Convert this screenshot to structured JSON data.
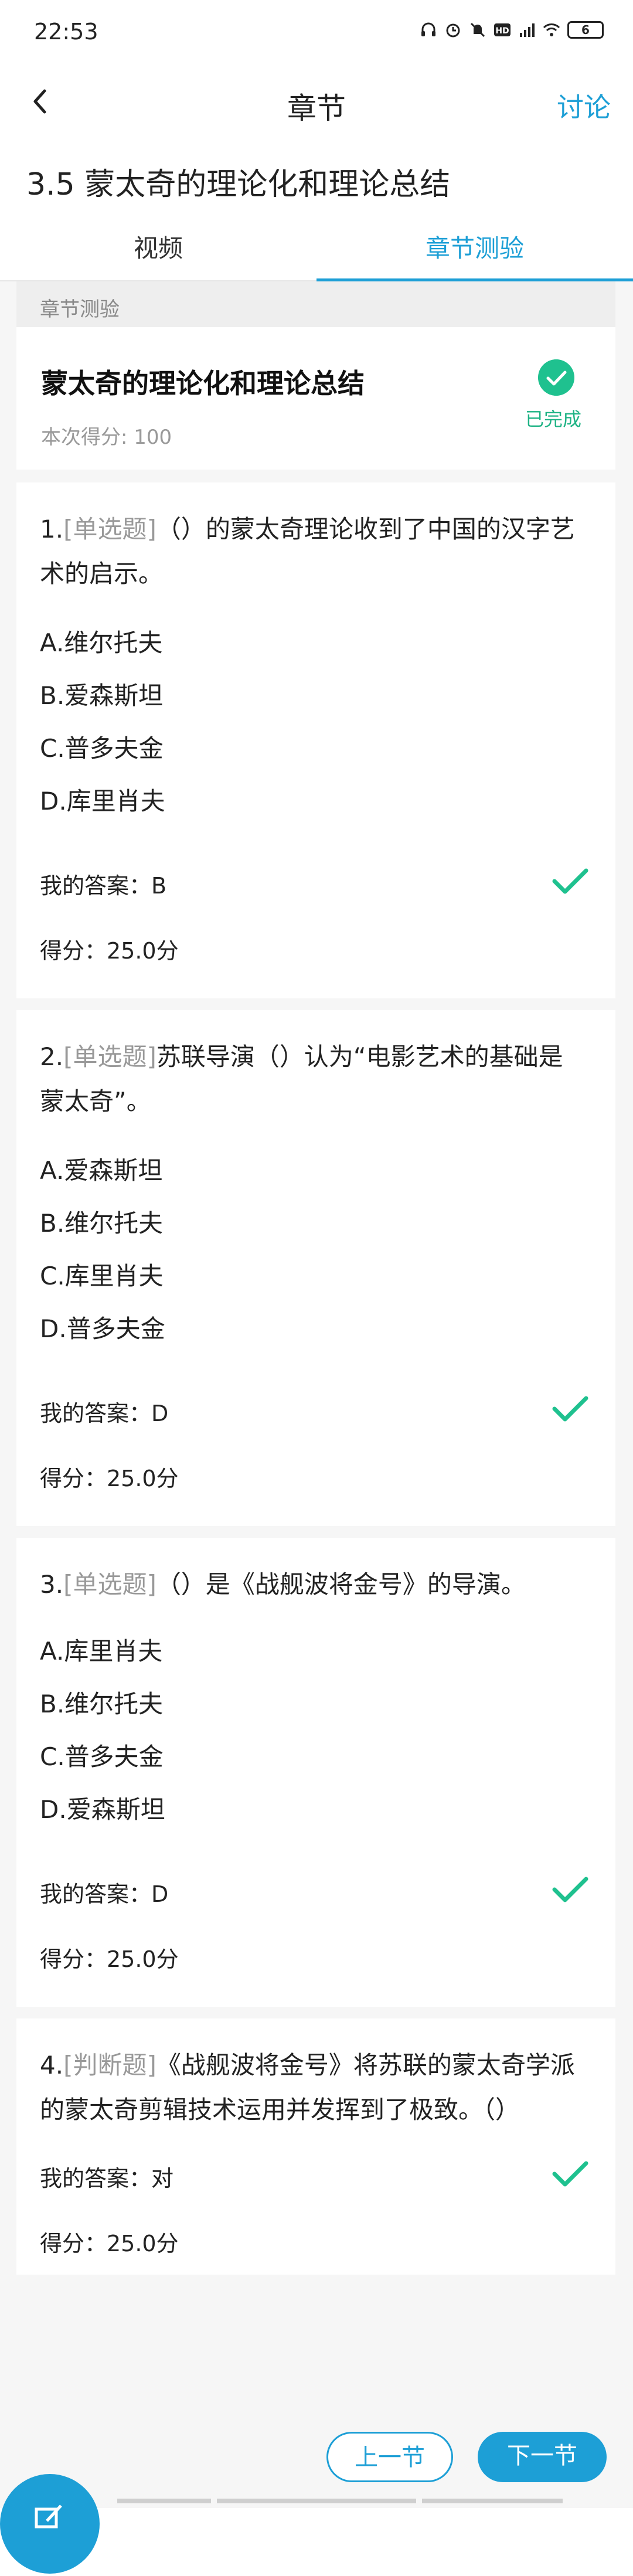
{
  "status_bar": {
    "time": "22:53",
    "battery": "6"
  },
  "nav": {
    "title": "章节",
    "discuss": "讨论"
  },
  "chapter_heading": "3.5 蒙太奇的理论化和理论总结",
  "tabs": [
    {
      "label": "视频"
    },
    {
      "label": "章节测验"
    }
  ],
  "section_label": "章节测验",
  "summary": {
    "title": "蒙太奇的理论化和理论总结",
    "score": "本次得分: 100",
    "status": "已完成"
  },
  "questions": [
    {
      "number": "1.",
      "type": "[单选题]",
      "text": "（）的蒙太奇理论收到了中国的汉字艺术的启示。",
      "options": [
        "A.维尔托夫",
        "B.爱森斯坦",
        "C.普多夫金",
        "D.库里肖夫"
      ],
      "answer": "我的答案：B",
      "points": "得分：25.0分"
    },
    {
      "number": "2.",
      "type": "[单选题]",
      "text": "苏联导演（）认为“电影艺术的基础是蒙太奇”。",
      "options": [
        "A.爱森斯坦",
        "B.维尔托夫",
        "C.库里肖夫",
        "D.普多夫金"
      ],
      "answer": "我的答案：D",
      "points": "得分：25.0分"
    },
    {
      "number": "3.",
      "type": "[单选题]",
      "text": "（）是《战舰波将金号》的导演。",
      "options": [
        "A.库里肖夫",
        "B.维尔托夫",
        "C.普多夫金",
        "D.爱森斯坦"
      ],
      "answer": "我的答案：D",
      "points": "得分：25.0分"
    },
    {
      "number": "4.",
      "type": "[判断题]",
      "text": "《战舰波将金号》将苏联的蒙太奇学派的蒙太奇剪辑技术运用并发挥到了极致。（）",
      "options": [],
      "answer": "我的答案：对",
      "points": "得分：25.0分"
    }
  ],
  "footer": {
    "prev": "上一节",
    "next": "下一节"
  },
  "colors": {
    "accent": "#1d9fd6",
    "success": "#1fc18f"
  }
}
